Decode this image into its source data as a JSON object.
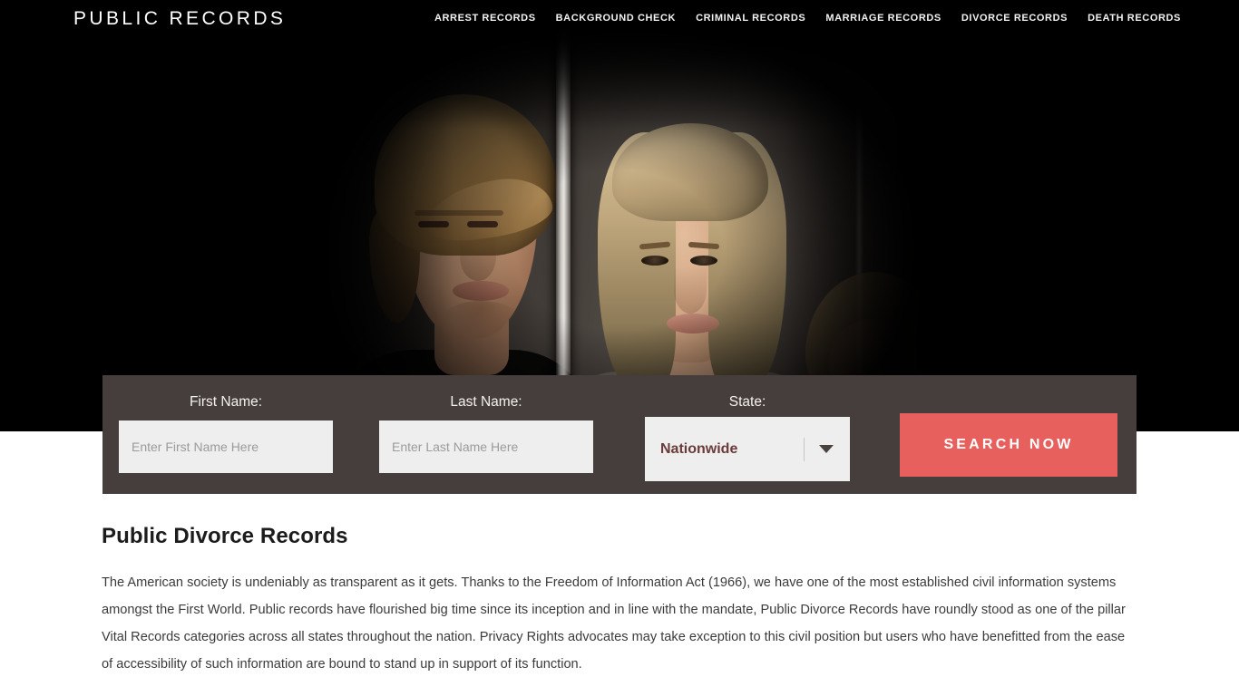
{
  "header": {
    "logo": "PUBLIC RECORDS",
    "nav": [
      {
        "label": "ARREST RECORDS"
      },
      {
        "label": "BACKGROUND CHECK"
      },
      {
        "label": "CRIMINAL RECORDS"
      },
      {
        "label": "MARRIAGE RECORDS"
      },
      {
        "label": "DIVORCE RECORDS"
      },
      {
        "label": "DEATH RECORDS"
      }
    ]
  },
  "hero": {
    "background_color": "#000000",
    "scene_description": "couple-separated-by-wall-photo"
  },
  "search_form": {
    "panel_color": "#463e3c",
    "first_name": {
      "label": "First Name:",
      "placeholder": "Enter First Name Here",
      "value": ""
    },
    "last_name": {
      "label": "Last Name:",
      "placeholder": "Enter Last Name Here",
      "value": ""
    },
    "state": {
      "label": "State:",
      "selected": "Nationwide"
    },
    "submit": {
      "label": "SEARCH NOW",
      "color": "#e8605e"
    }
  },
  "article": {
    "title": "Public Divorce Records",
    "body": "The American society is undeniably as transparent as it gets. Thanks to the Freedom of Information Act (1966), we have one of the most established civil information systems amongst the First World. Public records have flourished big time since its inception and in line with the mandate, Public Divorce Records have roundly stood as one of the pillar Vital Records categories across all states throughout the nation. Privacy Rights advocates may take exception to this civil position but users who have benefitted from the ease of accessibility of such information are bound to stand up in support of its function."
  }
}
